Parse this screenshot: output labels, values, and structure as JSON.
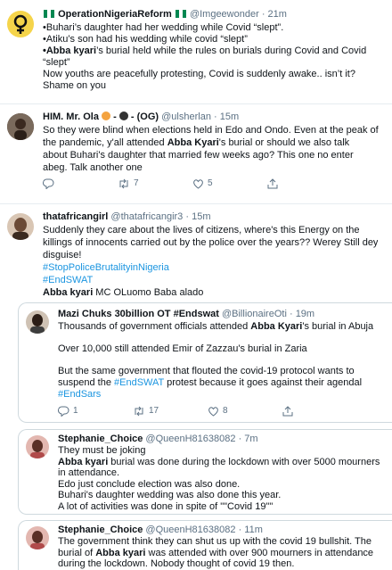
{
  "tweets": [
    {
      "name": "OperationNigeriaReform",
      "handle": "@Imgeewonder",
      "time": "· 21m",
      "lines": [
        "•Buhari’s daughter had her wedding while Covid “slept”.",
        "•Atiku’s son had his wedding while covid “slept”",
        "•Abba kyari’s burial held while the rules on burials during Covid and Covid",
        "“slept”",
        " Now youths are peacefully protesting, Covid is suddenly awake.. isn’t it?",
        "Shame on you"
      ],
      "bold_part": "•Abba kyari",
      "line3_rest": "’s burial held while the rules on burials during Covid and Covid"
    },
    {
      "name": "HIM. Mr. Ola",
      "name_suffix": "- (OG)",
      "handle": "@ulsherlan",
      "time": "· 15m",
      "lines": [
        "So they were blind when elections held in Edo and Ondo. Even at the peak of",
        "the pandemic, y'all attended ",
        "about Buhari's daughter that married few weeks ago? This one no enter",
        "abeg. Talk another one"
      ],
      "bold": "Abba Kyari",
      "line2_rest": "'s burial or should we also talk",
      "retweets": "7",
      "likes": "5"
    },
    {
      "name": "thatafricangirl",
      "handle": "@thatafricangir3",
      "time": "· 15m",
      "lines": [
        "Suddenly they care about the lives of citizens, where's this Energy on the",
        "killings of innocents carried out by the police over the years?? Werey Still dey",
        "disguise!"
      ],
      "tags": [
        "#StopPoliceBrutalityinNigeria",
        "#EndSWAT"
      ],
      "last_bold": "Abba kyari",
      "last_rest": " MC OLuomo Baba alado"
    },
    {
      "name": "Mazi Chuks 30billion OT #Endswat",
      "handle": "@BillionaireOti",
      "time": "· 19m",
      "line1_pre": "Thousands of government officials attended ",
      "line1_bold": "Abba Kyari",
      "line1_rest": "'s burial in Abuja",
      "line2": "Over 10,000 still attended Emir of Zazzau's burial in Zaria",
      "line3": "But the  same government that flouted the covid-19 protocol wants to",
      "line4_pre": "suspend the ",
      "line4_tag": "#EndSWAT",
      "line4_rest": " protest because it goes against their agendal",
      "line5_tag": "#EndSars",
      "replies": "1",
      "retweets": "17",
      "likes": "8"
    },
    {
      "name": "Stephanie_Choice",
      "handle": "@QueenH81638082",
      "time": "· 7m",
      "line1": "They must be joking",
      "line2_bold": "Abba kyari",
      "line2_rest": " burial was done during the lockdown with over 5000 mourners",
      "line3": "in attendance.",
      "line4": " Edo just conclude election was also done.",
      "line5": "Buhari's daughter wedding was also done this year.",
      "line6": "A lot of activities was done in spite of \"\"Covid 19\"\""
    },
    {
      "name": "Stephanie_Choice",
      "handle": "@QueenH81638082",
      "time": "· 11m",
      "line1": "The government think they can shut us up with the covid 19 bullshit. The",
      "line2_pre": "burial of ",
      "line2_bold": "Abba kyari",
      "line2_rest": " was attended with over 900 mourners in attendance",
      "line3": "during the lockdown. Nobody thought of covid 19 then."
    }
  ],
  "colors": {
    "link": "#1b95e0",
    "muted": "#5b7083",
    "flag_green": "#008751",
    "venus_bg": "#f5d44a"
  },
  "icons": [
    "reply-icon",
    "retweet-icon",
    "like-icon",
    "share-icon",
    "flag-ng-icon",
    "venus-icon"
  ]
}
